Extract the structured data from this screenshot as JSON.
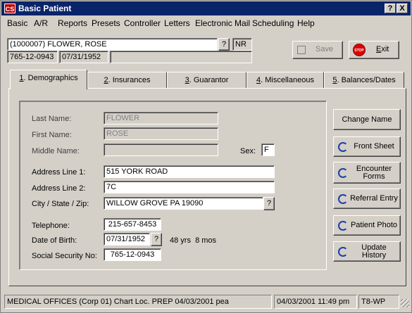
{
  "window": {
    "title": "Basic Patient",
    "app_icon_text": "CS",
    "help_btn": "?",
    "close_btn": "X"
  },
  "menu": [
    {
      "label": "Basic"
    },
    {
      "label": "A/R"
    },
    {
      "label": "Reports"
    },
    {
      "label": "Presets"
    },
    {
      "label": "Controller"
    },
    {
      "label": "Letters"
    },
    {
      "label": "Electronic Mail"
    },
    {
      "label": "Scheduling"
    },
    {
      "label": "Help"
    }
  ],
  "header": {
    "patient": "(1000007) FLOWER, ROSE",
    "lookup_btn": "?",
    "status_code": "NR",
    "ssn": "765-12-0943",
    "dob": "07/31/1952",
    "extra": ""
  },
  "actions": {
    "save": "Save",
    "exit": "Exit",
    "stop_icon_text": "STOP"
  },
  "tabs": [
    {
      "num": "1",
      "label": "Demographics"
    },
    {
      "num": "2",
      "label": "Insurances"
    },
    {
      "num": "3",
      "label": "Guarantor"
    },
    {
      "num": "4",
      "label": "Miscellaneous"
    },
    {
      "num": "5",
      "label": "Balances/Dates"
    }
  ],
  "form": {
    "last_name_label": "Last Name:",
    "last_name": "FLOWER",
    "first_name_label": "First Name:",
    "first_name": "ROSE",
    "middle_name_label": "Middle Name:",
    "middle_name": "",
    "sex_label": "Sex:",
    "sex": "F",
    "addr1_label": "Address Line 1:",
    "addr1": "515 YORK ROAD",
    "addr2_label": "Address Line 2:",
    "addr2": "7C",
    "city_label": "City / State / Zip:",
    "city": "WILLOW GROVE PA 19090",
    "city_btn": "?",
    "phone_label": "Telephone:",
    "phone": "215-657-8453",
    "dob_label": "Date of Birth:",
    "dob": "07/31/1952",
    "dob_btn": "?",
    "age": "48 yrs  8 mos",
    "ssn_label": "Social Security No:",
    "ssn": "765-12-0943"
  },
  "side_buttons": {
    "change_name": "Change Name",
    "front_sheet": "Front Sheet",
    "encounter_forms": "Encounter Forms",
    "referral_entry": "Referral Entry",
    "patient_photo": "Patient Photo",
    "update_history": "Update History"
  },
  "statusbar": {
    "office": "MEDICAL OFFICES (Corp 01) Chart Loc. PREP 04/03/2001 pea",
    "datetime": "04/03/2001 11:49 pm",
    "station": "T8-WP"
  }
}
